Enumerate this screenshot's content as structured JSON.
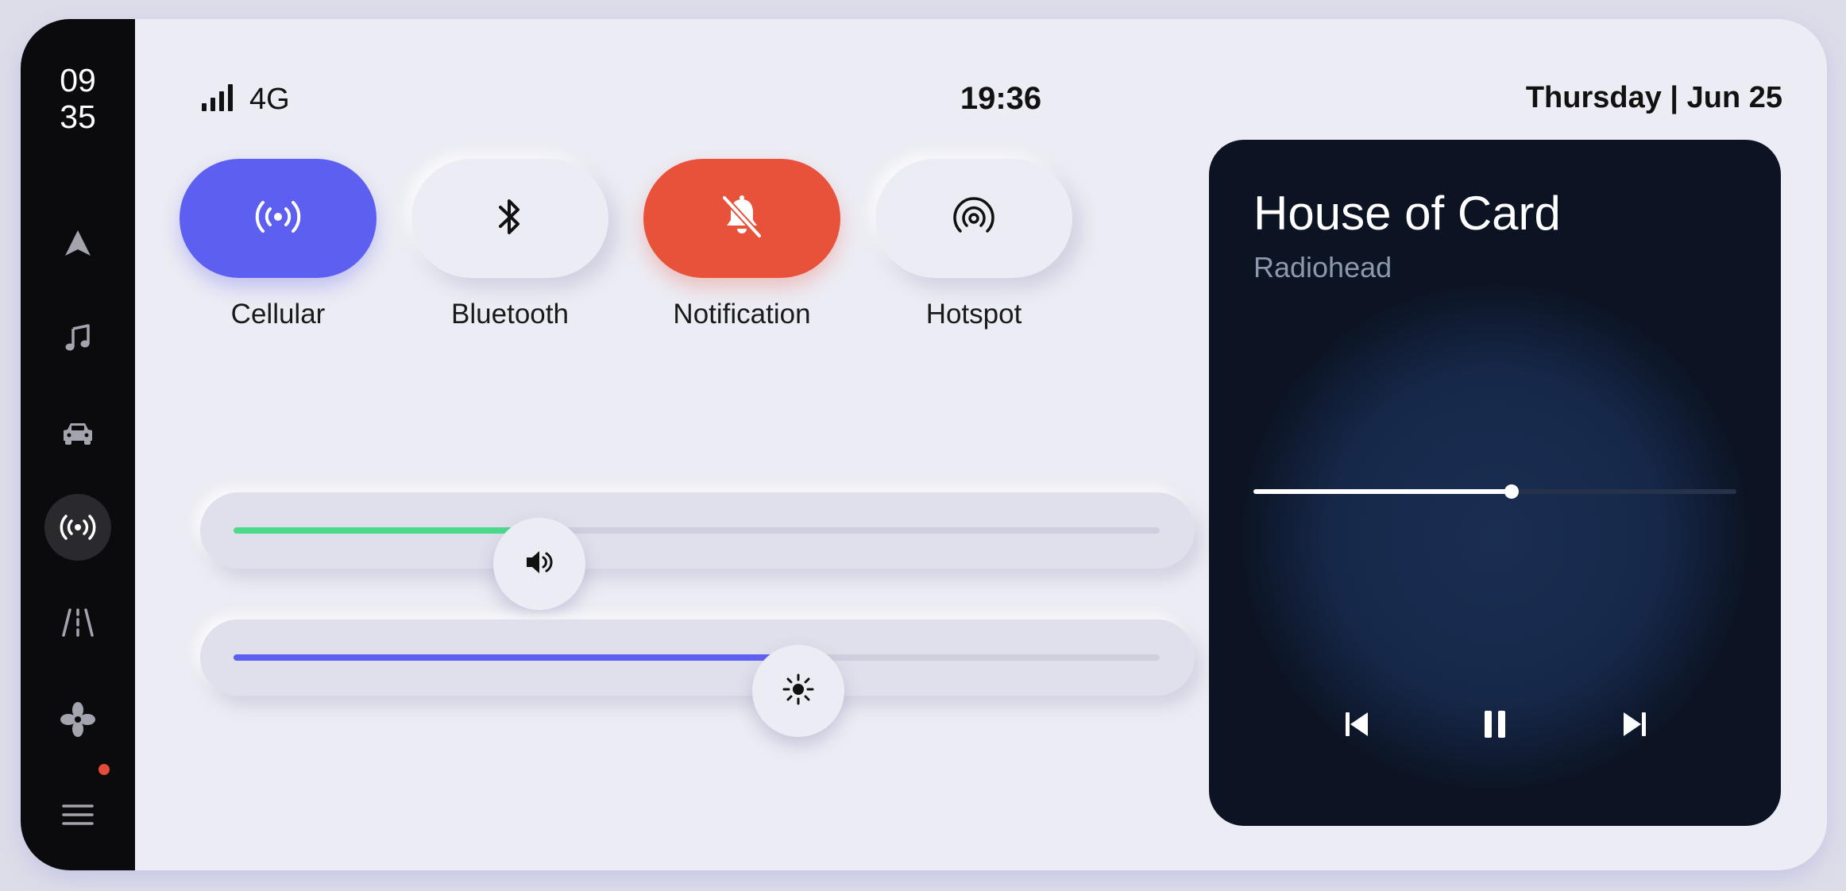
{
  "sidebar": {
    "clock_hour": "09",
    "clock_minute": "35",
    "items": [
      {
        "name": "navigation",
        "icon": "navigation-arrow-icon"
      },
      {
        "name": "music",
        "icon": "music-note-icon"
      },
      {
        "name": "car",
        "icon": "car-icon"
      },
      {
        "name": "connectivity",
        "icon": "broadcast-icon",
        "active": true
      },
      {
        "name": "road",
        "icon": "road-icon"
      },
      {
        "name": "fan",
        "icon": "fan-icon"
      },
      {
        "name": "menu",
        "icon": "menu-icon",
        "has_notification": true
      }
    ]
  },
  "status": {
    "network": "4G",
    "time": "19:36",
    "date": "Thursday | Jun 25"
  },
  "toggles": [
    {
      "label": "Cellular",
      "icon": "broadcast-icon",
      "state": "on",
      "color": "#5d5ff0"
    },
    {
      "label": "Bluetooth",
      "icon": "bluetooth-icon",
      "state": "off"
    },
    {
      "label": "Notification",
      "icon": "bell-off-icon",
      "state": "on",
      "color": "#e8513a"
    },
    {
      "label": "Hotspot",
      "icon": "hotspot-icon",
      "state": "off"
    }
  ],
  "sliders": {
    "volume": {
      "level": 0.33,
      "color": "#4cd98a",
      "icon": "speaker-icon"
    },
    "brightness": {
      "level": 0.61,
      "color": "#5d5ff0",
      "icon": "sun-icon"
    }
  },
  "media": {
    "title": "House of Card",
    "artist": "Radiohead",
    "progress": 0.535,
    "controls": [
      "previous-icon",
      "pause-icon",
      "next-icon"
    ]
  },
  "colors": {
    "accent_blue": "#5d5ff0",
    "accent_red": "#e8513a",
    "accent_green": "#4cd98a",
    "sidebar_bg": "#0b0b0d",
    "card_bg": "#0c1322"
  }
}
